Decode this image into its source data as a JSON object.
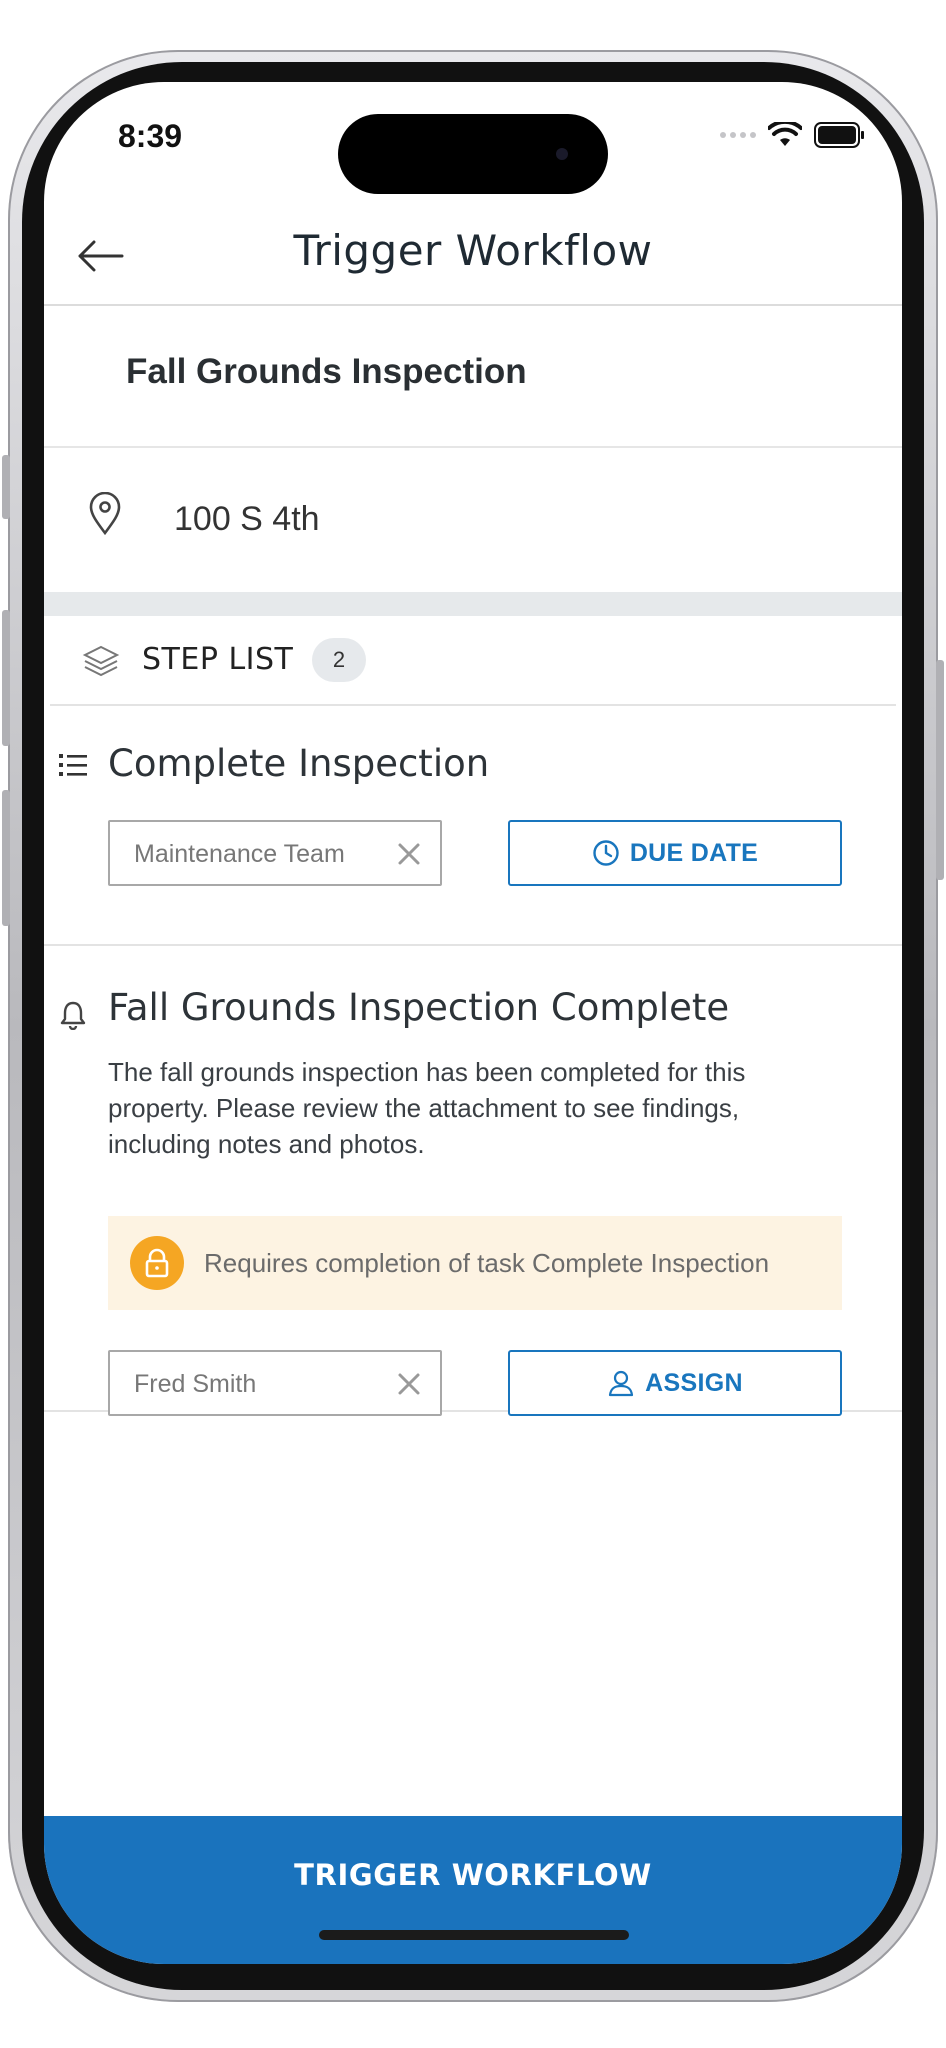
{
  "status_bar": {
    "time": "8:39"
  },
  "header": {
    "title": "Trigger Workflow",
    "back_icon": "arrow-left-icon"
  },
  "workflow": {
    "name": "Fall Grounds Inspection",
    "address": "100 S 4th",
    "address_icon": "location-pin-icon"
  },
  "step_list": {
    "label": "STEP LIST",
    "count": "2",
    "icon": "layers-icon",
    "steps": [
      {
        "icon": "task-list-icon",
        "title": "Complete Inspection",
        "assignee": "Maintenance Team",
        "action_label": "DUE DATE",
        "action_icon": "clock-icon"
      },
      {
        "icon": "bell-icon",
        "title": "Fall Grounds Inspection Complete",
        "description": "The fall grounds inspection has been completed for this property. Please review the attachment to see findings, including notes and photos.",
        "dependency": "Requires completion of task Complete Inspection",
        "dependency_icon": "lock-icon",
        "assignee": "Fred Smith",
        "action_label": "ASSIGN",
        "action_icon": "user-icon"
      }
    ]
  },
  "footer": {
    "trigger_label": "TRIGGER WORKFLOW"
  },
  "colors": {
    "accent": "#1a73bd",
    "warning": "#f5a623",
    "warning_bg": "#fdf3e2"
  }
}
